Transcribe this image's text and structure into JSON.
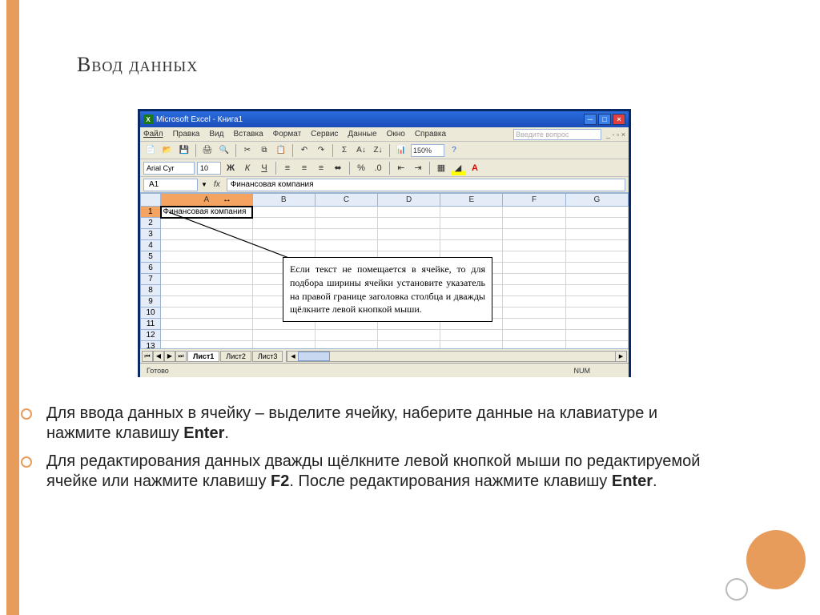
{
  "slide": {
    "title": "Ввод данных"
  },
  "excel": {
    "title": "Microsoft Excel - Книга1",
    "menu": {
      "file": "Файл",
      "edit": "Правка",
      "view": "Вид",
      "insert": "Вставка",
      "format": "Формат",
      "tools": "Сервис",
      "data": "Данные",
      "window": "Окно",
      "help": "Справка",
      "search_placeholder": "Введите вопрос"
    },
    "toolbar": {
      "zoom": "150%"
    },
    "format": {
      "font_name": "Arial Cyr",
      "font_size": "10"
    },
    "formula": {
      "name_box": "A1",
      "fx": "fx",
      "value": "Финансовая компания"
    },
    "columns": [
      "A",
      "B",
      "C",
      "D",
      "E",
      "F",
      "G"
    ],
    "rows": [
      "1",
      "2",
      "3",
      "4",
      "5",
      "6",
      "7",
      "8",
      "9",
      "10",
      "11",
      "12",
      "13"
    ],
    "cell_a1": "Финансовая компания",
    "callout": "Если текст не помещается в ячейке, то для подбора ширины ячейки установите указатель на правой границе заголовка столбца и дважды щёлкните левой кнопкой мыши.",
    "sheets": {
      "sheet1": "Лист1",
      "sheet2": "Лист2",
      "sheet3": "Лист3"
    },
    "status": {
      "ready": "Готово",
      "num": "NUM"
    }
  },
  "bullets": {
    "item1_part1": "Для ввода данных в ячейку – выделите ячейку, наберите данные на клавиатуре и нажмите клавишу ",
    "item1_key": "Enter",
    "item2_part1": "Для редактирования данных дважды щёлкните левой кнопкой мыши по редактируемой ячейке или нажмите клавишу ",
    "item2_key1": "F2",
    "item2_part2": ". После редактирования нажмите клавишу ",
    "item2_key2": "Enter",
    "period": "."
  }
}
